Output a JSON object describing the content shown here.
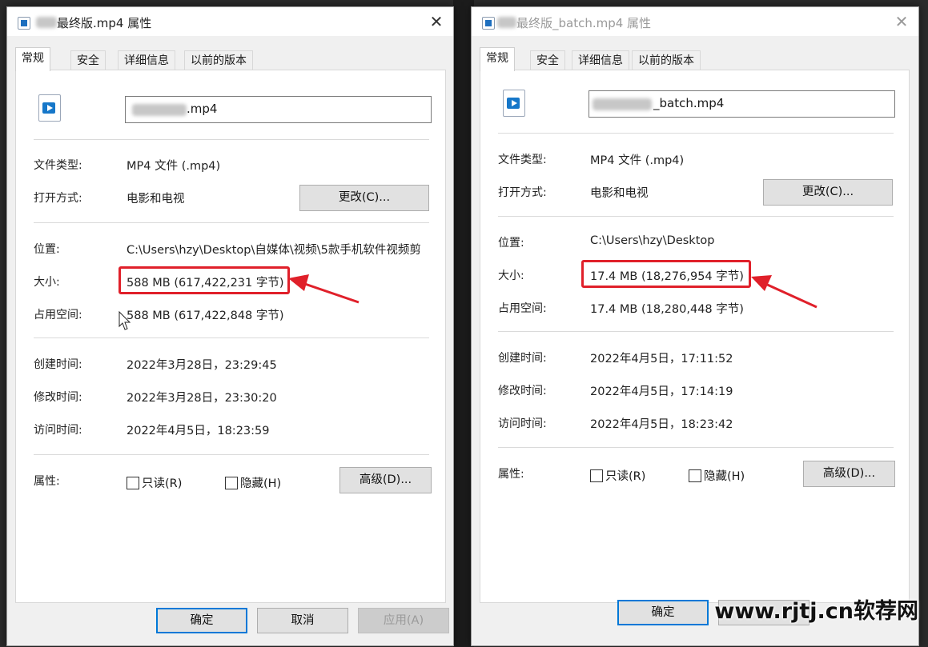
{
  "left_dialog": {
    "title_suffix": "最终版.mp4 属性",
    "close_glyph": "✕",
    "tabs": [
      "常规",
      "安全",
      "详细信息",
      "以前的版本"
    ],
    "filename_suffix": ".mp4",
    "labels": {
      "type": "文件类型:",
      "open_with": "打开方式:",
      "location": "位置:",
      "size": "大小:",
      "size_on_disk": "占用空间:",
      "created": "创建时间:",
      "modified": "修改时间:",
      "accessed": "访问时间:",
      "attributes": "属性:"
    },
    "values": {
      "type": "MP4 文件 (.mp4)",
      "open_with": "电影和电视",
      "location": "C:\\Users\\hzy\\Desktop\\自媒体\\视频\\5款手机软件视频剪",
      "size": "588 MB (617,422,231 字节)",
      "size_on_disk": "588 MB (617,422,848 字节)",
      "created": "2022年3月28日，23:29:45",
      "modified": "2022年3月28日，23:30:20",
      "accessed": "2022年4月5日，18:23:59"
    },
    "change_button": "更改(C)...",
    "readonly_label": "只读(R)",
    "hidden_label": "隐藏(H)",
    "advanced_button": "高级(D)...",
    "ok_button": "确定",
    "cancel_button": "取消",
    "apply_button": "应用(A)"
  },
  "right_dialog": {
    "title_suffix": "最终版_batch.mp4 属性",
    "close_glyph": "✕",
    "tabs": [
      "常规",
      "安全",
      "详细信息",
      "以前的版本"
    ],
    "filename_suffix": "_batch.mp4",
    "labels": {
      "type": "文件类型:",
      "open_with": "打开方式:",
      "location": "位置:",
      "size": "大小:",
      "size_on_disk": "占用空间:",
      "created": "创建时间:",
      "modified": "修改时间:",
      "accessed": "访问时间:",
      "attributes": "属性:"
    },
    "values": {
      "type": "MP4 文件 (.mp4)",
      "open_with": "电影和电视",
      "location": "C:\\Users\\hzy\\Desktop",
      "size": "17.4 MB (18,276,954 字节)",
      "size_on_disk": "17.4 MB (18,280,448 字节)",
      "created": "2022年4月5日，17:11:52",
      "modified": "2022年4月5日，17:14:19",
      "accessed": "2022年4月5日，18:23:42"
    },
    "change_button": "更改(C)...",
    "readonly_label": "只读(R)",
    "hidden_label": "隐藏(H)",
    "advanced_button": "高级(D)...",
    "ok_button": "确定"
  },
  "watermark": "www.rjtj.cn软荐网",
  "colors": {
    "highlight": "#e0202a",
    "accent": "#0078d7",
    "window_bg": "#f0f0f0",
    "backdrop": "#2b2b2b"
  }
}
